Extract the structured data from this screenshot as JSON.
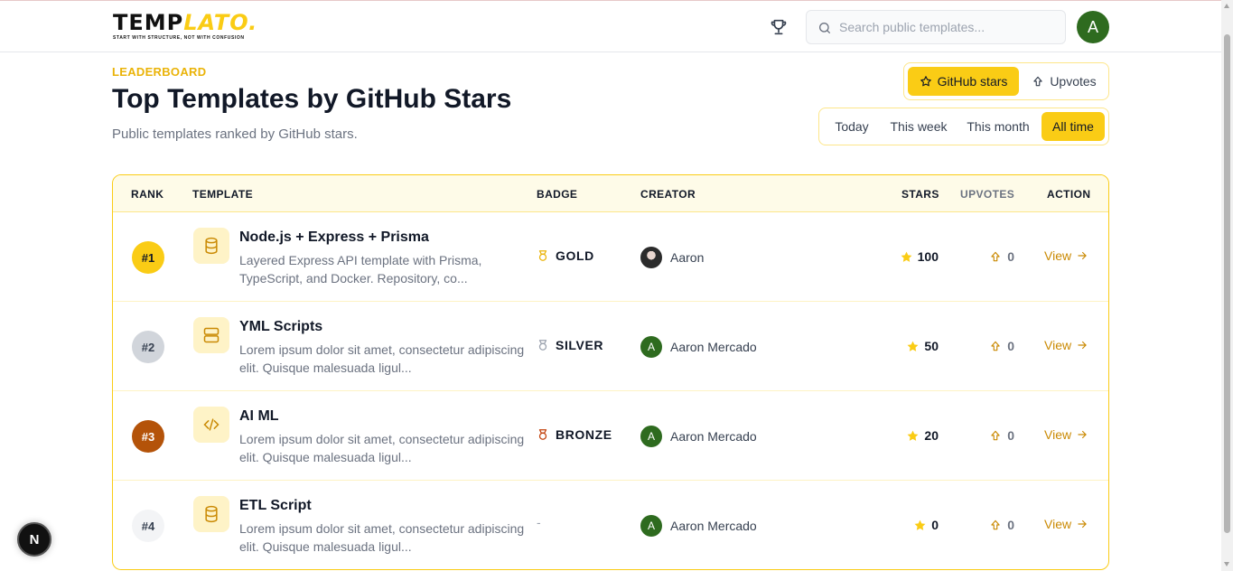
{
  "header": {
    "logo_text_a": "TEMP",
    "logo_text_b": "LATO.",
    "logo_tagline": "START WITH STRUCTURE, NOT WITH CONFUSION",
    "search_placeholder": "Search public templates...",
    "avatar_initial": "A"
  },
  "page": {
    "eyebrow": "LEADERBOARD",
    "title": "Top Templates by GitHub Stars",
    "subtitle": "Public templates ranked by GitHub stars."
  },
  "metric_toggle": {
    "options": [
      "GitHub stars",
      "Upvotes"
    ],
    "selected": "GitHub stars"
  },
  "range_toggle": {
    "options": [
      "Today",
      "This week",
      "This month",
      "All time"
    ],
    "selected": "All time"
  },
  "table": {
    "headers": [
      "RANK",
      "TEMPLATE",
      "BADGE",
      "CREATOR",
      "STARS",
      "UPVOTES",
      "ACTION"
    ],
    "rows": [
      {
        "rank": "#1",
        "rank_color": "#facc15",
        "rank_text_color": "#111827",
        "icon": "database-icon",
        "name": "Node.js + Express + Prisma",
        "desc": "Layered Express API template with Prisma, TypeScript, and Docker. Repository, co...",
        "badge": "GOLD",
        "badge_color": "#eab308",
        "creator": "Aaron",
        "creator_avatar": "photo",
        "stars": "100",
        "upvotes": "0",
        "action": "View"
      },
      {
        "rank": "#2",
        "rank_color": "#d1d5db",
        "rank_text_color": "#374151",
        "icon": "server-icon",
        "name": "YML Scripts",
        "desc": "Lorem ipsum dolor sit amet, consectetur adipiscing elit. Quisque malesuada ligul...",
        "badge": "SILVER",
        "badge_color": "#9ca3af",
        "creator": "Aaron Mercado",
        "creator_avatar": "A",
        "stars": "50",
        "upvotes": "0",
        "action": "View"
      },
      {
        "rank": "#3",
        "rank_color": "#b45309",
        "rank_text_color": "#ffffff",
        "icon": "code-icon",
        "name": "AI ML",
        "desc": "Lorem ipsum dolor sit amet, consectetur adipiscing elit. Quisque malesuada ligul...",
        "badge": "BRONZE",
        "badge_color": "#c2410c",
        "creator": "Aaron Mercado",
        "creator_avatar": "A",
        "stars": "20",
        "upvotes": "0",
        "action": "View"
      },
      {
        "rank": "#4",
        "rank_color": "#f3f4f6",
        "rank_text_color": "#374151",
        "icon": "database-icon",
        "name": "ETL Script",
        "desc": "Lorem ipsum dolor sit amet, consectetur adipiscing elit. Quisque malesuada ligul...",
        "badge": "-",
        "badge_color": "#9ca3af",
        "creator": "Aaron Mercado",
        "creator_avatar": "A",
        "stars": "0",
        "upvotes": "0",
        "action": "View"
      }
    ]
  },
  "dev_badge": "N",
  "colors": {
    "accent": "#facc15",
    "link": "#ca8a04",
    "avatar": "#2e6b1f"
  }
}
